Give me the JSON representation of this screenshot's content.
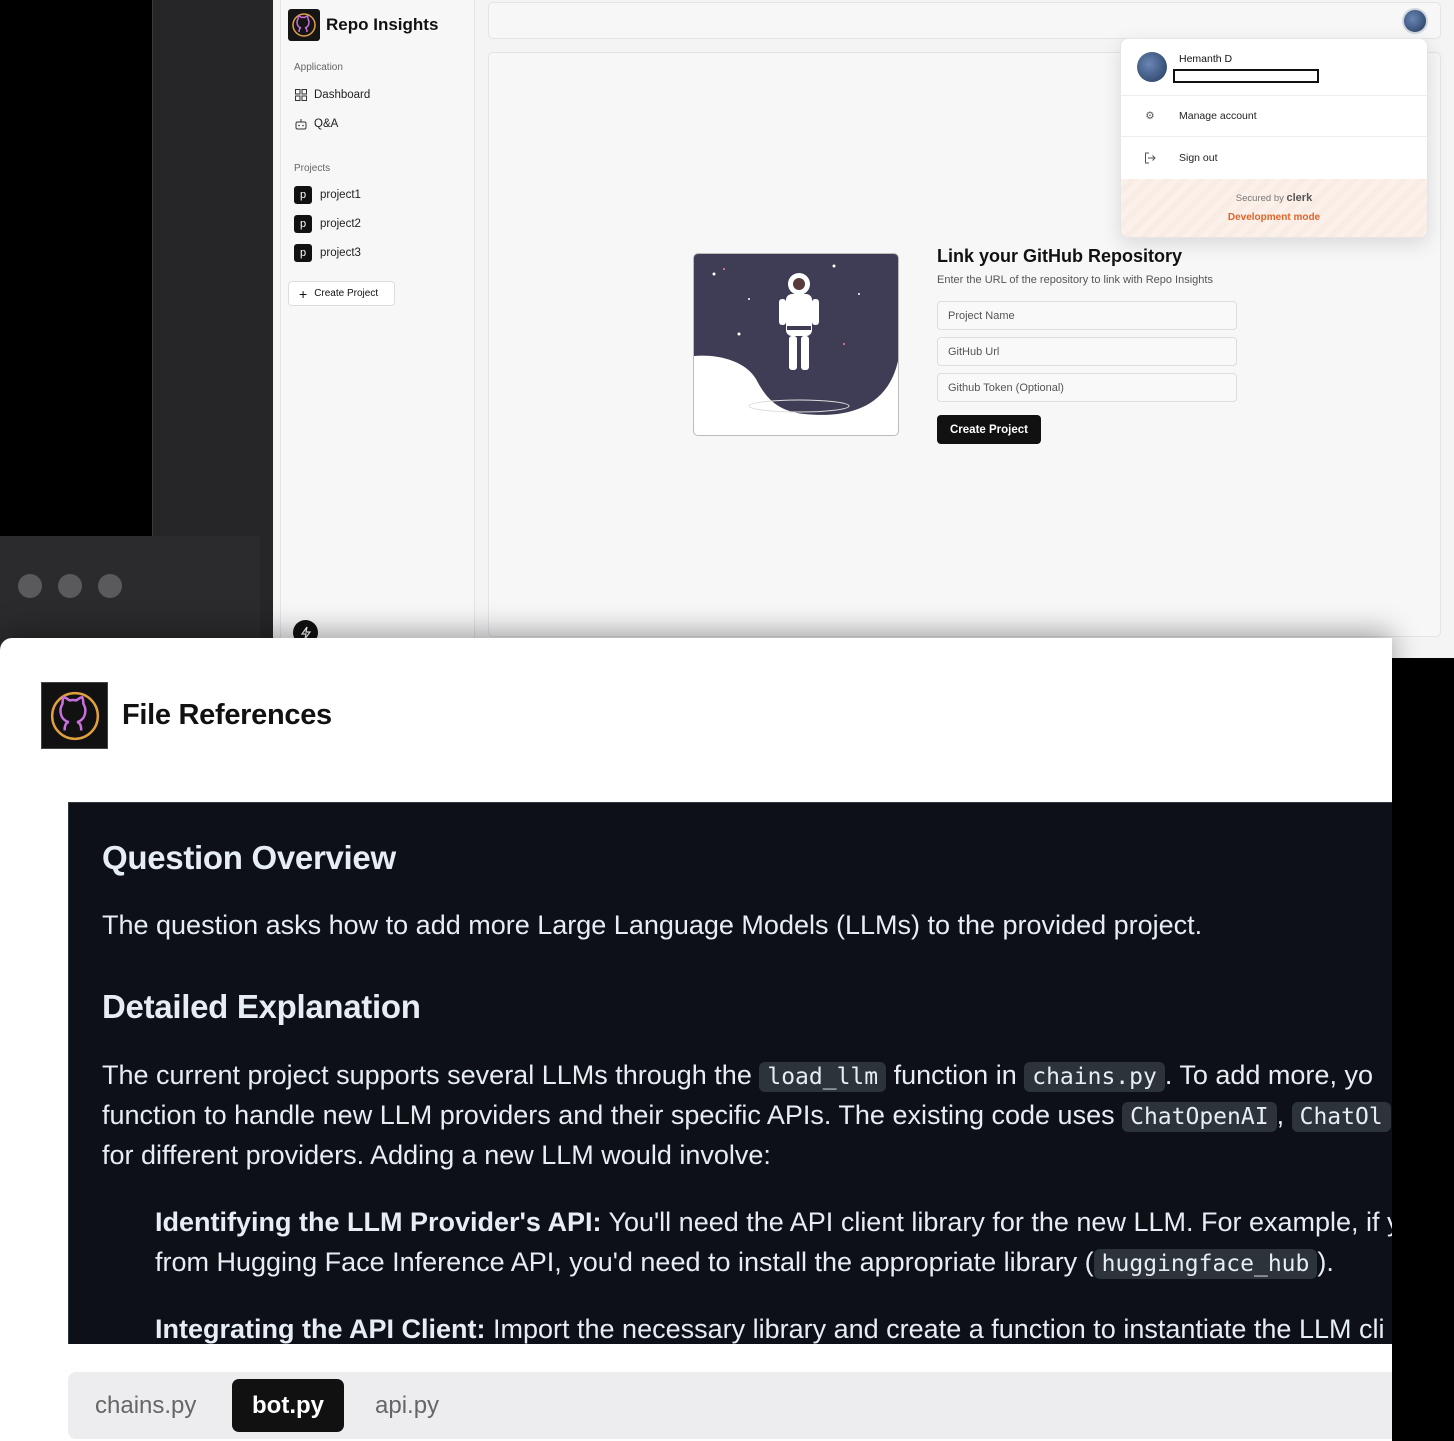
{
  "app": {
    "name": "Repo Insights",
    "sidebar": {
      "application_label": "Application",
      "nav": [
        {
          "label": "Dashboard",
          "icon": "dashboard-icon"
        },
        {
          "label": "Q&A",
          "icon": "bot-icon"
        }
      ],
      "projects_label": "Projects",
      "projects": [
        {
          "badge": "p",
          "label": "project1"
        },
        {
          "badge": "p",
          "label": "project2"
        },
        {
          "badge": "p",
          "label": "project3"
        }
      ],
      "create_project_label": "Create Project"
    },
    "main": {
      "title": "Link your GitHub Repository",
      "subtitle": "Enter the URL of the repository to link with Repo Insights",
      "fields": {
        "project_name_placeholder": "Project Name",
        "github_url_placeholder": "GitHub Url",
        "github_token_placeholder": "Github Token (Optional)"
      },
      "submit_label": "Create Project"
    },
    "user_popup": {
      "name": "Hemanth D",
      "manage_label": "Manage account",
      "signout_label": "Sign out",
      "secured_by": "Secured by",
      "secured_brand": "clerk",
      "mode": "Development mode",
      "mode_color": "#e0652a"
    }
  },
  "dialog": {
    "title": "File References",
    "content": {
      "h1": "Question Overview",
      "p1": "The question asks how to add more Large Language Models (LLMs) to the provided project.",
      "h2": "Detailed Explanation",
      "p2_a": "The current project supports several LLMs through the ",
      "p2_code1": "load_llm",
      "p2_b": " function in ",
      "p2_code2": "chains.py",
      "p2_c": ". To add more, yo",
      "p2_line2_a": "function to handle new LLM providers and their specific APIs. The existing code uses ",
      "p2_code3": "ChatOpenAI",
      "p2_line2_b": ", ",
      "p2_code4": "ChatOl",
      "p2_line3": "for different providers. Adding a new LLM would involve:",
      "li1_bold": "Identifying the LLM Provider's API:",
      "li1_a": " You'll need the API client library for the new LLM. For example, if y",
      "li1_line2_a": "from Hugging Face Inference API, you'd need to install the appropriate library (",
      "li1_code": "huggingface_hub",
      "li1_line2_b": ").",
      "li2_bold": "Integrating the API Client:",
      "li2_a": " Import the necessary library and create a function to instantiate the LLM cli"
    },
    "tabs": [
      {
        "label": "chains.py",
        "active": false
      },
      {
        "label": "bot.py",
        "active": true
      },
      {
        "label": "api.py",
        "active": false
      }
    ],
    "md_background": "#0d1117"
  }
}
